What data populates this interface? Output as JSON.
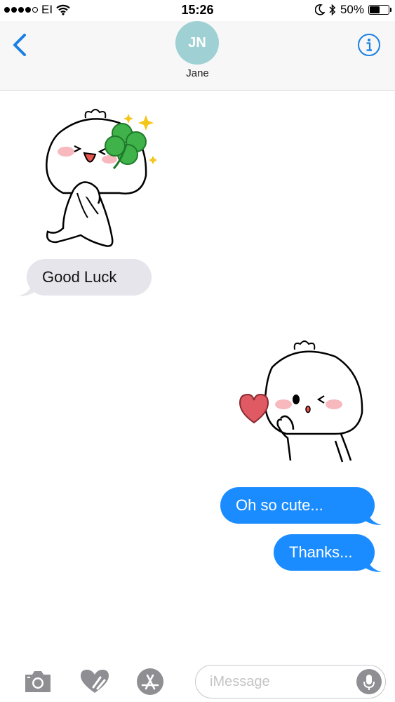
{
  "status_bar": {
    "carrier": "EI",
    "time": "15:26",
    "battery_percent": "50%",
    "battery_level": 0.5,
    "signal_bars_filled": 4,
    "icons": [
      "wifi-icon",
      "moon-icon",
      "bluetooth-icon",
      "battery-icon"
    ]
  },
  "header": {
    "avatar_initials": "JN",
    "contact_name": "Jane",
    "avatar_color": "#9fd1d4",
    "accent_color": "#1a7fe3",
    "icons": [
      "chevron-left-icon",
      "info-icon"
    ]
  },
  "messages": [
    {
      "direction": "incoming",
      "type": "sticker",
      "sticker": "bun-with-four-leaf-clover"
    },
    {
      "direction": "incoming",
      "type": "text",
      "text": "Good Luck"
    },
    {
      "direction": "outgoing",
      "type": "sticker",
      "sticker": "bun-winking-with-heart"
    },
    {
      "direction": "outgoing",
      "type": "text",
      "text": "Oh so cute..."
    },
    {
      "direction": "outgoing",
      "type": "text",
      "text": "Thanks..."
    }
  ],
  "bubble_colors": {
    "incoming": "#e6e5eb",
    "outgoing": "#1a8cff"
  },
  "input_bar": {
    "placeholder": "iMessage",
    "icons": [
      "camera-icon",
      "digital-touch-icon",
      "app-store-icon",
      "microphone-icon"
    ]
  }
}
